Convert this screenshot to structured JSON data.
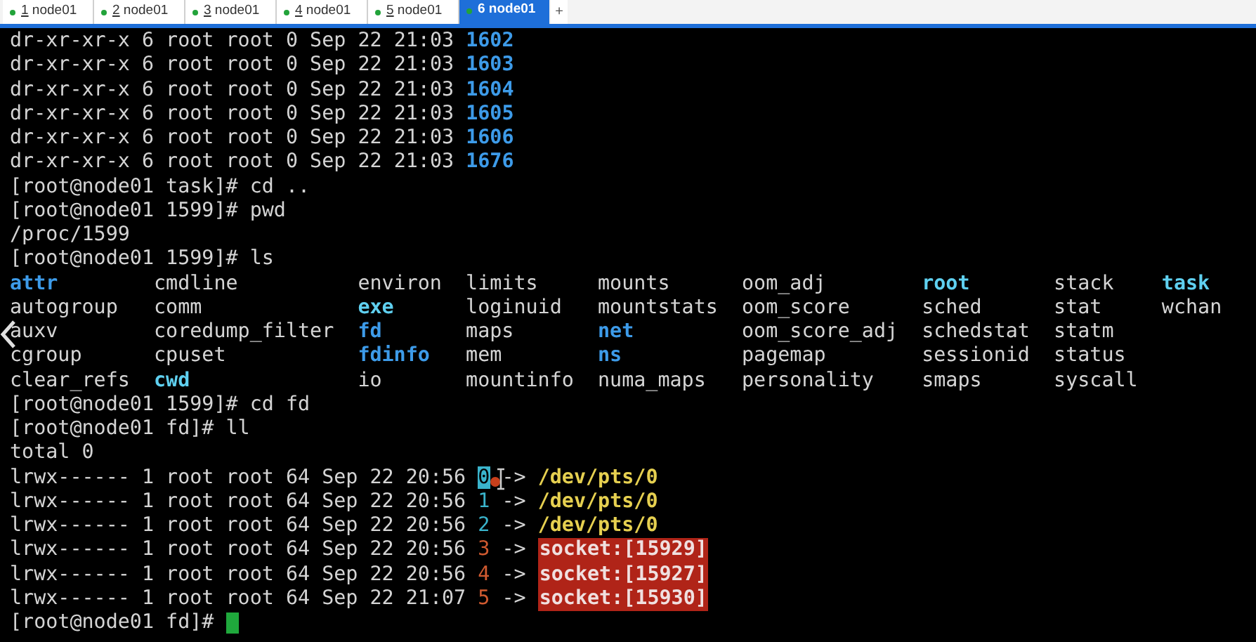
{
  "tabs": [
    {
      "number": "1",
      "label": "node01",
      "selected": false
    },
    {
      "number": "2",
      "label": "node01",
      "selected": false
    },
    {
      "number": "3",
      "label": "node01",
      "selected": false
    },
    {
      "number": "4",
      "label": "node01",
      "selected": false
    },
    {
      "number": "5",
      "label": "node01",
      "selected": false
    },
    {
      "number": "6",
      "label": "node01",
      "selected": true
    }
  ],
  "new_tab_button": "+",
  "terminal": {
    "lines": [
      {
        "segments": [
          {
            "text": "dr-xr-xr-x 6 root root 0 Sep 22 21:03",
            "kind": "plain"
          },
          {
            "text": "1602",
            "kind": "dir"
          }
        ]
      },
      {
        "segments": [
          {
            "text": "dr-xr-xr-x 6 root root 0 Sep 22 21:03",
            "kind": "plain"
          },
          {
            "text": "1603",
            "kind": "dir"
          }
        ]
      },
      {
        "segments": [
          {
            "text": "dr-xr-xr-x 6 root root 0 Sep 22 21:03",
            "kind": "plain"
          },
          {
            "text": "1604",
            "kind": "dir"
          }
        ]
      },
      {
        "segments": [
          {
            "text": "dr-xr-xr-x 6 root root 0 Sep 22 21:03",
            "kind": "plain"
          },
          {
            "text": "1605",
            "kind": "dir"
          }
        ]
      },
      {
        "segments": [
          {
            "text": "dr-xr-xr-x 6 root root 0 Sep 22 21:03",
            "kind": "plain"
          },
          {
            "text": "1606",
            "kind": "dir"
          }
        ]
      },
      {
        "segments": [
          {
            "text": "dr-xr-xr-x 6 root root 0 Sep 22 21:03",
            "kind": "plain"
          },
          {
            "text": "1676",
            "kind": "dir"
          }
        ]
      },
      {
        "segments": [
          {
            "text": "[root@node01 task]# cd ..",
            "kind": "plain"
          }
        ]
      },
      {
        "segments": [
          {
            "text": "[root@node01 1599]# pwd",
            "kind": "plain"
          }
        ]
      },
      {
        "segments": [
          {
            "text": "/proc/1599",
            "kind": "plain"
          }
        ]
      },
      {
        "segments": [
          {
            "text": "[root@node01 1599]# ls",
            "kind": "plain"
          }
        ]
      },
      {
        "listing": [
          [
            {
              "text": "attr",
              "kind": "dir"
            },
            {
              "text": "cmdline",
              "kind": "plain"
            },
            {
              "text": "environ",
              "kind": "plain"
            },
            {
              "text": "limits",
              "kind": "plain"
            },
            {
              "text": "mounts",
              "kind": "plain"
            },
            {
              "text": "oom_adj",
              "kind": "plain"
            },
            {
              "text": "root",
              "kind": "link"
            },
            {
              "text": "stack",
              "kind": "plain"
            },
            {
              "text": "task",
              "kind": "link"
            }
          ],
          [
            {
              "text": "autogroup",
              "kind": "plain"
            },
            {
              "text": "comm",
              "kind": "plain"
            },
            {
              "text": "exe",
              "kind": "link"
            },
            {
              "text": "loginuid",
              "kind": "plain"
            },
            {
              "text": "mountstats",
              "kind": "plain"
            },
            {
              "text": "oom_score",
              "kind": "plain"
            },
            {
              "text": "sched",
              "kind": "plain"
            },
            {
              "text": "stat",
              "kind": "plain"
            },
            {
              "text": "wchan",
              "kind": "plain"
            }
          ],
          [
            {
              "text": "auxv",
              "kind": "plain"
            },
            {
              "text": "coredump_filter",
              "kind": "plain"
            },
            {
              "text": "fd",
              "kind": "dir"
            },
            {
              "text": "maps",
              "kind": "plain"
            },
            {
              "text": "net",
              "kind": "dir"
            },
            {
              "text": "oom_score_adj",
              "kind": "plain"
            },
            {
              "text": "schedstat",
              "kind": "plain"
            },
            {
              "text": "statm",
              "kind": "plain"
            }
          ],
          [
            {
              "text": "cgroup",
              "kind": "plain"
            },
            {
              "text": "cpuset",
              "kind": "plain"
            },
            {
              "text": "fdinfo",
              "kind": "dir"
            },
            {
              "text": "mem",
              "kind": "plain"
            },
            {
              "text": "ns",
              "kind": "dir"
            },
            {
              "text": "pagemap",
              "kind": "plain"
            },
            {
              "text": "sessionid",
              "kind": "plain"
            },
            {
              "text": "status",
              "kind": "plain"
            }
          ],
          [
            {
              "text": "clear_refs",
              "kind": "plain"
            },
            {
              "text": "cwd",
              "kind": "link"
            },
            {
              "text": "io",
              "kind": "plain"
            },
            {
              "text": "mountinfo",
              "kind": "plain"
            },
            {
              "text": "numa_maps",
              "kind": "plain"
            },
            {
              "text": "personality",
              "kind": "plain"
            },
            {
              "text": "smaps",
              "kind": "plain"
            },
            {
              "text": "syscall",
              "kind": "plain"
            }
          ]
        ]
      },
      {
        "segments": [
          {
            "text": "[root@node01 1599]# cd fd",
            "kind": "plain"
          }
        ]
      },
      {
        "segments": [
          {
            "text": "[root@node01 fd]# ll",
            "kind": "plain"
          }
        ]
      },
      {
        "segments": [
          {
            "text": "total 0",
            "kind": "plain"
          }
        ]
      },
      {
        "segments": [
          {
            "text": "lrwx------ 1 root root 64 Sep 22 20:56",
            "kind": "plain"
          },
          {
            "text": "0",
            "kind": "fd",
            "highlighted": true,
            "pointer": true
          },
          {
            "text": "->",
            "kind": "plain"
          },
          {
            "text": "/dev/pts/0",
            "kind": "target"
          }
        ]
      },
      {
        "segments": [
          {
            "text": "lrwx------ 1 root root 64 Sep 22 20:56",
            "kind": "plain"
          },
          {
            "text": "1",
            "kind": "fd"
          },
          {
            "text": "->",
            "kind": "plain"
          },
          {
            "text": "/dev/pts/0",
            "kind": "target"
          }
        ]
      },
      {
        "segments": [
          {
            "text": "lrwx------ 1 root root 64 Sep 22 20:56",
            "kind": "plain"
          },
          {
            "text": "2",
            "kind": "fd"
          },
          {
            "text": "->",
            "kind": "plain"
          },
          {
            "text": "/dev/pts/0",
            "kind": "target"
          }
        ]
      },
      {
        "segments": [
          {
            "text": "lrwx------ 1 root root 64 Sep 22 20:56",
            "kind": "plain"
          },
          {
            "text": "3",
            "kind": "fdsocket"
          },
          {
            "text": "->",
            "kind": "plain"
          },
          {
            "text": "socket:[15929]",
            "kind": "socket"
          }
        ]
      },
      {
        "segments": [
          {
            "text": "lrwx------ 1 root root 64 Sep 22 20:56",
            "kind": "plain"
          },
          {
            "text": "4",
            "kind": "fdsocket"
          },
          {
            "text": "->",
            "kind": "plain"
          },
          {
            "text": "socket:[15927]",
            "kind": "socket"
          }
        ]
      },
      {
        "segments": [
          {
            "text": "lrwx------ 1 root root 64 Sep 22 21:07",
            "kind": "plain"
          },
          {
            "text": "5",
            "kind": "fdsocket"
          },
          {
            "text": "->",
            "kind": "plain"
          },
          {
            "text": "socket:[15930]",
            "kind": "socket"
          }
        ]
      },
      {
        "segments": [
          {
            "text": "[root@node01 fd]#",
            "kind": "plain"
          }
        ],
        "cursor": true
      }
    ]
  }
}
